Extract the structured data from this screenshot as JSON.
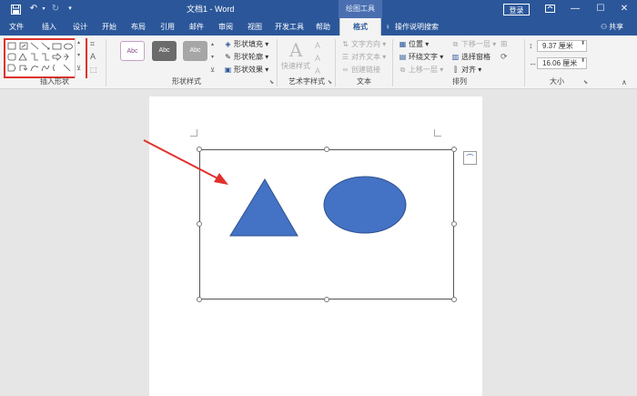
{
  "titlebar": {
    "doc_title": "文档1 - Word",
    "context_header": "绘图工具",
    "login_label": "登录",
    "qat_icons": [
      "save-icon",
      "undo-icon",
      "redo-icon",
      "customize-qat-icon"
    ]
  },
  "tabs": {
    "items": [
      "文件",
      "插入",
      "设计",
      "开始",
      "布局",
      "引用",
      "邮件",
      "审阅",
      "视图",
      "开发工具",
      "帮助",
      "格式"
    ],
    "active": "格式",
    "tellme": "操作说明搜索",
    "share": "共享"
  },
  "ribbon": {
    "insert_shapes": {
      "label": "插入形状"
    },
    "shape_styles": {
      "label": "形状样式",
      "thumbs": [
        "Abc",
        "Abc",
        "Abc"
      ],
      "fill": "形状填充",
      "outline": "形状轮廓",
      "effect": "形状效果"
    },
    "wordart": {
      "label": "艺术字样式",
      "quick_styles": "快速样式"
    },
    "text": {
      "label": "文本",
      "direction": "文字方向",
      "align": "对齐文本",
      "link": "创建链接"
    },
    "arrange": {
      "label": "排列",
      "position": "位置",
      "wrap": "环绕文字",
      "forward": "上移一层",
      "backward": "下移一层",
      "selection_pane": "选择窗格",
      "align": "对齐"
    },
    "size": {
      "label": "大小",
      "height": "9.37 厘米",
      "width": "16.06 厘米"
    }
  },
  "colors": {
    "brand": "#2b579a",
    "shape_fill": "#4472c4",
    "arrow": "#e0322b",
    "selection_box": "#e0322b"
  }
}
